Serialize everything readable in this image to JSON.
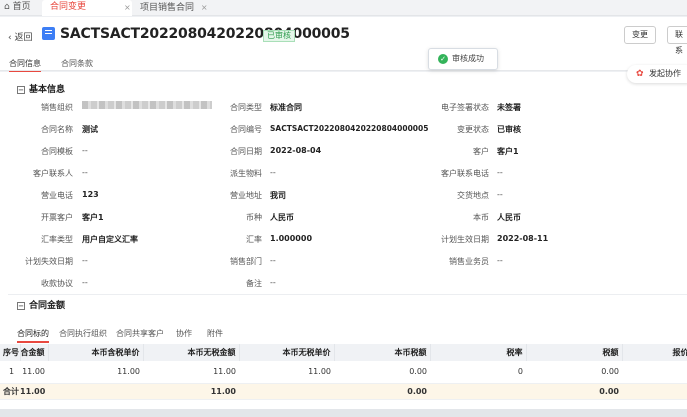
{
  "tabs": [
    {
      "label": "首页",
      "icon": "home-icon"
    },
    {
      "label": "合同变更",
      "active": true
    },
    {
      "label": "项目销售合同"
    }
  ],
  "header": {
    "back_label": "返回",
    "title": "SACTSACT2022080420220804000005",
    "status": "已审核",
    "buttons": [
      "变更",
      "联系"
    ]
  },
  "toast": {
    "message": "审核成功"
  },
  "subtabs": [
    "合同信息",
    "合同条款"
  ],
  "assist_label": "发起协作",
  "basic_section": {
    "title": "基本信息"
  },
  "fields": [
    {
      "label": "销售组织",
      "value": ""
    },
    {
      "label": "合同类型",
      "value": "标准合同"
    },
    {
      "label": "电子签署状态",
      "value": "未签署"
    },
    {
      "label": "合同名称",
      "value": "测试"
    },
    {
      "label": "合同编号",
      "value": "SACTSACT2022080420220804000005"
    },
    {
      "label": "变更状态",
      "value": "已审核"
    },
    {
      "label": "合同模板",
      "value": "--"
    },
    {
      "label": "合同日期",
      "value": "2022-08-04"
    },
    {
      "label": "客户",
      "value": "客户1"
    },
    {
      "label": "客户联系人",
      "value": "--"
    },
    {
      "label": "派生物料",
      "value": "--"
    },
    {
      "label": "客户联系电话",
      "value": "--"
    },
    {
      "label": "营业电话",
      "value": "123"
    },
    {
      "label": "营业地址",
      "value": "我司"
    },
    {
      "label": "交货地点",
      "value": "--"
    },
    {
      "label": "开票客户",
      "value": "客户1"
    },
    {
      "label": "币种",
      "value": "人民币"
    },
    {
      "label": "本币",
      "value": "人民币"
    },
    {
      "label": "汇率类型",
      "value": "用户自定义汇率"
    },
    {
      "label": "汇率",
      "value": "1.000000"
    },
    {
      "label": "计划生效日期",
      "value": "2022-08-11"
    },
    {
      "label": "计划失效日期",
      "value": "--"
    },
    {
      "label": "销售部门",
      "value": "--"
    },
    {
      "label": "销售业务员",
      "value": "--"
    },
    {
      "label": "收款协议",
      "value": "--"
    },
    {
      "label": "备注",
      "value": "--"
    }
  ],
  "amount_section": {
    "title": "合同金额"
  },
  "lower_tabs": [
    "合同标的",
    "合同执行组织",
    "合同共享客户",
    "协作",
    "附件"
  ],
  "table": {
    "columns": [
      "序号",
      "合金额",
      "本币含税单价",
      "本币无税金额",
      "本币无税单价",
      "本币税额",
      "税率",
      "税额",
      "报价含"
    ],
    "rows": [
      [
        "1",
        "11.00",
        "11.00",
        "11.00",
        "11.00",
        "0.00",
        "0",
        "0.00",
        ""
      ]
    ],
    "sum_label": "合计",
    "sum": [
      "11.00",
      "",
      "11.00",
      "",
      "0.00",
      "",
      "0.00",
      ""
    ]
  },
  "colors": {
    "accent": "#e8483f",
    "status_green": "#2b9a4b",
    "doc_blue": "#3d7ef5"
  }
}
